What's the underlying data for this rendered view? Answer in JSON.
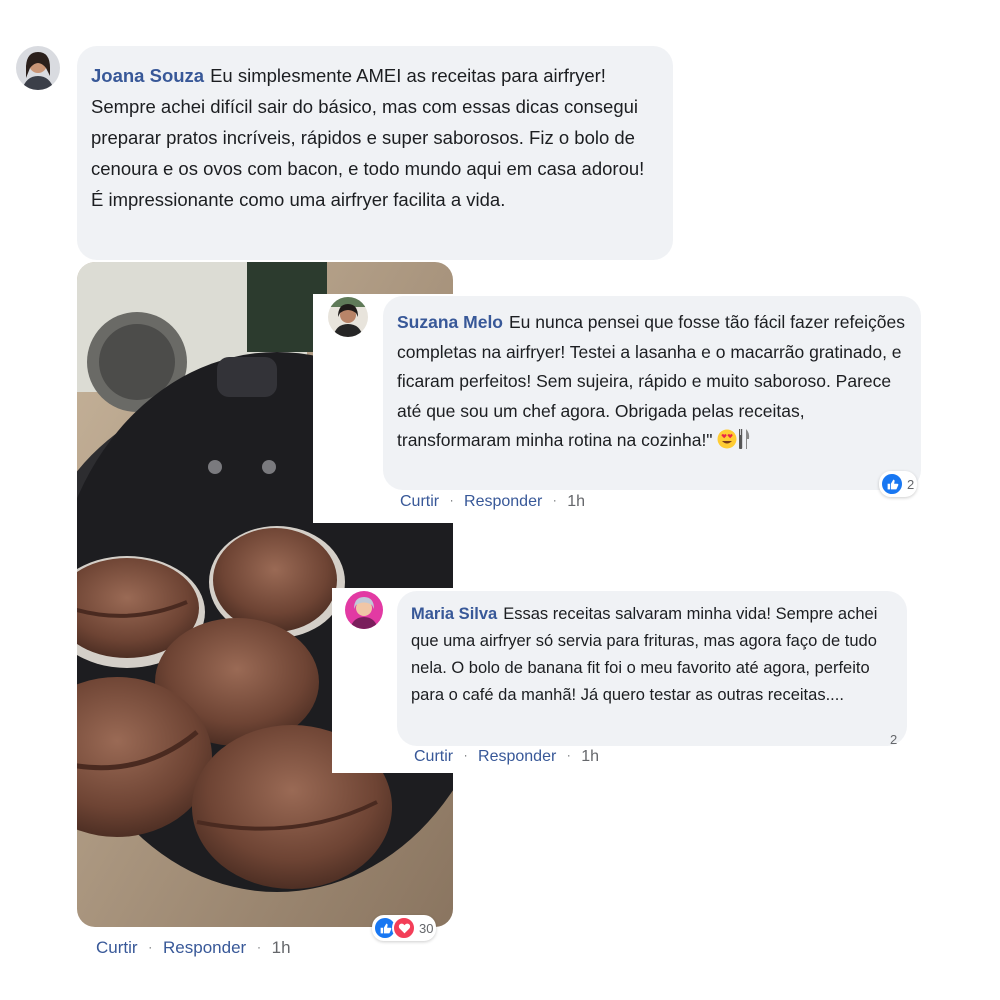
{
  "comments": [
    {
      "author": "Joana Souza",
      "text": "Eu simplesmente AMEI as receitas para airfryer! Sempre achei difícil sair do básico, mas com essas dicas consegui preparar pratos incríveis, rápidos e super saborosos. Fiz o bolo de cenoura e os ovos com bacon, e todo mundo aqui em casa adorou! É impressionante como uma airfryer facilita a vida.",
      "like_label": "Curtir",
      "reply_label": "Responder",
      "time": "1h",
      "reaction_count": "30",
      "reactions": [
        "like-icon",
        "love-icon"
      ],
      "has_photo": true
    },
    {
      "author": "Suzana Melo",
      "text": "Eu nunca pensei que fosse tão fácil fazer refeições completas na airfryer! Testei a lasanha e o macarrão gratinado, e ficaram perfeitos! Sem sujeira, rápido e muito saboroso. Parece até que sou um chef agora. Obrigada pelas receitas, transformaram minha rotina na cozinha!\"",
      "emojis": [
        "heart-eyes-emoji",
        "fork-knife-emoji"
      ],
      "like_label": "Curtir",
      "reply_label": "Responder",
      "time": "1h",
      "reaction_count": "2",
      "reactions": [
        "like-icon"
      ]
    },
    {
      "author": "Maria Silva",
      "text": "Essas receitas salvaram minha vida! Sempre achei que uma airfryer só servia para frituras, mas agora faço de tudo nela. O bolo de banana fit foi o meu favorito até agora, perfeito para o café da manhã! Já quero testar as outras receitas....",
      "like_label": "Curtir",
      "reply_label": "Responder",
      "time": "1h",
      "reaction_count": "2",
      "reactions": []
    }
  ],
  "separator": "·",
  "colors": {
    "bubble": "#f0f2f5",
    "author": "#385898",
    "meta": "#65676b",
    "like_blue": "#1877f2",
    "love_red": "#f33e58"
  }
}
